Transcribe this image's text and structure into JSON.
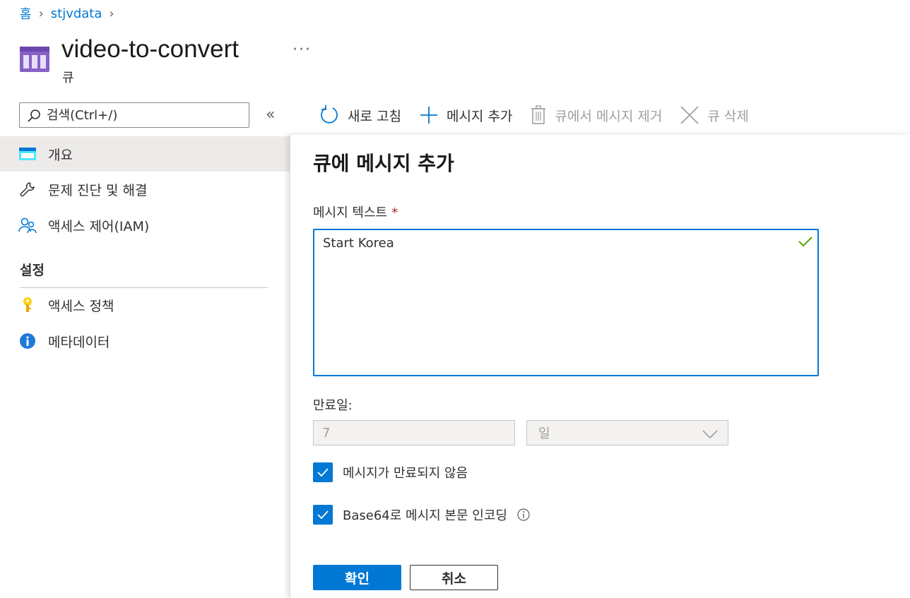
{
  "breadcrumb": {
    "home": "홈",
    "resource": "stjvdata"
  },
  "header": {
    "title": "video-to-convert",
    "subtitle": "큐",
    "more": "···"
  },
  "search": {
    "placeholder": "검색(Ctrl+/)",
    "collapse": "«"
  },
  "sidebar": {
    "items": [
      {
        "label": "개요",
        "icon": "queue-overview-icon"
      },
      {
        "label": "문제 진단 및 해결",
        "icon": "wrench-icon"
      },
      {
        "label": "액세스 제어(IAM)",
        "icon": "people-icon"
      }
    ],
    "settings_title": "설정",
    "settings_items": [
      {
        "label": "액세스 정책",
        "icon": "key-icon"
      },
      {
        "label": "메타데이터",
        "icon": "info-icon"
      }
    ]
  },
  "toolbar": {
    "refresh": "새로 고침",
    "add_message": "메시지 추가",
    "dequeue": "큐에서 메시지 제거",
    "delete_queue": "큐 삭제"
  },
  "panel": {
    "title": "큐에 메시지 추가",
    "message_label": "메시지 텍스트",
    "required_mark": "*",
    "message_value": "Start Korea",
    "expiry_label": "만료일:",
    "expiry_value": "7",
    "expiry_unit": "일",
    "never_expire_label": "메시지가 만료되지 않음",
    "never_expire_checked": true,
    "base64_label": "Base64로 메시지 본문 인코딩",
    "base64_checked": true,
    "ok": "확인",
    "cancel": "취소"
  },
  "colors": {
    "accent": "#0078d4",
    "success": "#57a300",
    "required": "#a4262c",
    "queue_icon": "#8661c5"
  }
}
